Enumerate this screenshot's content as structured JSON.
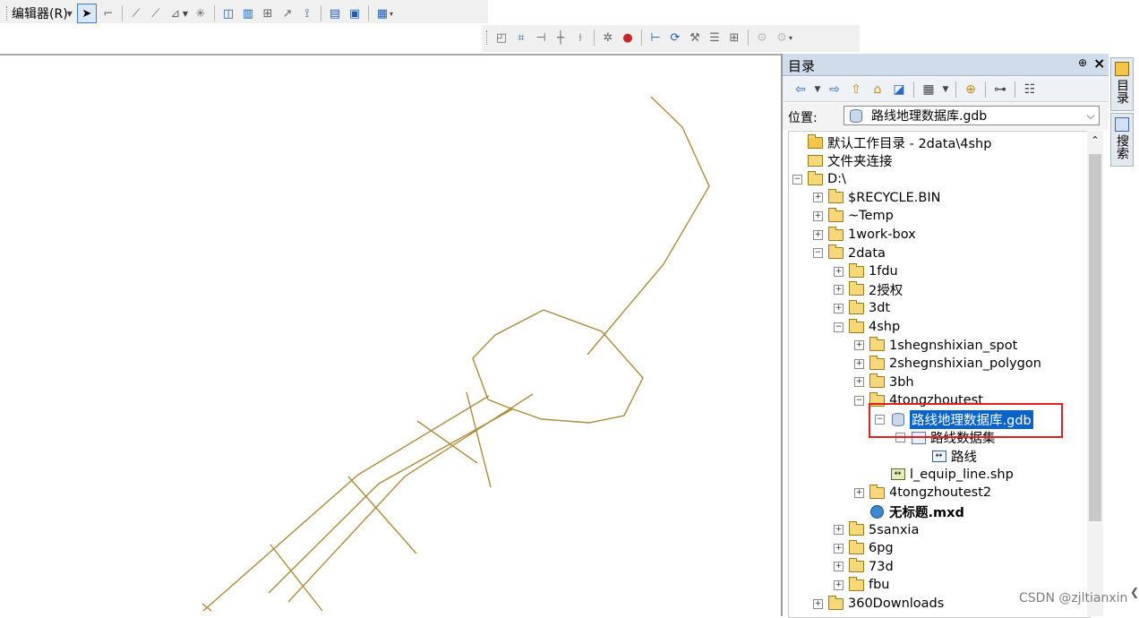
{
  "toolbar1": {
    "editor_label": "编辑器(R)",
    "icons": [
      "edit-pointer-icon",
      "edit-vertices-icon",
      "reshape-icon",
      "cut-polygon-icon",
      "split-icon",
      "rotate-icon",
      "attributes-icon",
      "sketch-properties-icon",
      "create-features-icon",
      "table-icon",
      "chart-icon",
      "customize-icon"
    ]
  },
  "toolbar2": {
    "icons": [
      "select-features-icon",
      "topology-edit-icon",
      "snap-icon",
      "extend-icon",
      "trim-icon",
      "sparkle-icon",
      "globe-icon",
      "network-icon",
      "refresh-icon",
      "geocode-icon",
      "list-icon",
      "grid-icon",
      "disabled-a-icon",
      "disabled-b-icon"
    ]
  },
  "panel": {
    "title": "目录",
    "pin": "⊕",
    "close": "×",
    "location_label": "位置:",
    "location_value": "路线地理数据库.gdb"
  },
  "tree": [
    {
      "label": "默认工作目录 - 2data\\4shp",
      "icon": "home-folder",
      "level": 0,
      "expander": "none"
    },
    {
      "label": "文件夹连接",
      "icon": "folder-connection",
      "level": 0,
      "expander": "none"
    },
    {
      "label": "D:\\",
      "icon": "folder",
      "level": 0,
      "expander": "minus"
    },
    {
      "label": "$RECYCLE.BIN",
      "icon": "folder",
      "level": 1,
      "expander": "plus"
    },
    {
      "label": "~Temp",
      "icon": "folder",
      "level": 1,
      "expander": "plus"
    },
    {
      "label": "1work-box",
      "icon": "folder",
      "level": 1,
      "expander": "plus"
    },
    {
      "label": "2data",
      "icon": "folder",
      "level": 1,
      "expander": "minus"
    },
    {
      "label": "1fdu",
      "icon": "folder",
      "level": 2,
      "expander": "plus"
    },
    {
      "label": "2授权",
      "icon": "folder",
      "level": 2,
      "expander": "plus"
    },
    {
      "label": "3dt",
      "icon": "folder",
      "level": 2,
      "expander": "plus"
    },
    {
      "label": "4shp",
      "icon": "folder",
      "level": 2,
      "expander": "minus"
    },
    {
      "label": "1shegnshixian_spot",
      "icon": "folder",
      "level": 3,
      "expander": "plus"
    },
    {
      "label": "2shegnshixian_polygon",
      "icon": "folder",
      "level": 3,
      "expander": "plus"
    },
    {
      "label": "3bh",
      "icon": "folder",
      "level": 3,
      "expander": "plus"
    },
    {
      "label": "4tongzhoutest",
      "icon": "folder",
      "level": 3,
      "expander": "minus"
    },
    {
      "label": "路线地理数据库.gdb",
      "icon": "gdb",
      "level": 4,
      "expander": "minus",
      "selected": true
    },
    {
      "label": "路线数据集",
      "icon": "feature-dataset",
      "level": 5,
      "expander": "minus"
    },
    {
      "label": "路线",
      "icon": "feature-class",
      "level": 6,
      "expander": "none"
    },
    {
      "label": "l_equip_line.shp",
      "icon": "shapefile",
      "level": 4,
      "expander": "none"
    },
    {
      "label": "4tongzhoutest2",
      "icon": "folder",
      "level": 3,
      "expander": "plus"
    },
    {
      "label": "无标题.mxd",
      "icon": "mxd",
      "level": 3,
      "expander": "none",
      "bold": true
    },
    {
      "label": "5sanxia",
      "icon": "folder",
      "level": 2,
      "expander": "plus"
    },
    {
      "label": "6pg",
      "icon": "folder",
      "level": 2,
      "expander": "plus"
    },
    {
      "label": "73d",
      "icon": "folder",
      "level": 2,
      "expander": "plus"
    },
    {
      "label": "fbu",
      "icon": "folder",
      "level": 2,
      "expander": "plus"
    },
    {
      "label": "360Downloads",
      "icon": "folder",
      "level": 1,
      "expander": "plus"
    }
  ],
  "side_tabs": [
    {
      "label": "目录",
      "icon": "catalog-icon"
    },
    {
      "label": "搜索",
      "icon": "search-icon"
    }
  ],
  "map": {
    "line_color": "#a98c3c"
  },
  "watermark": "CSDN @zjltianxin"
}
